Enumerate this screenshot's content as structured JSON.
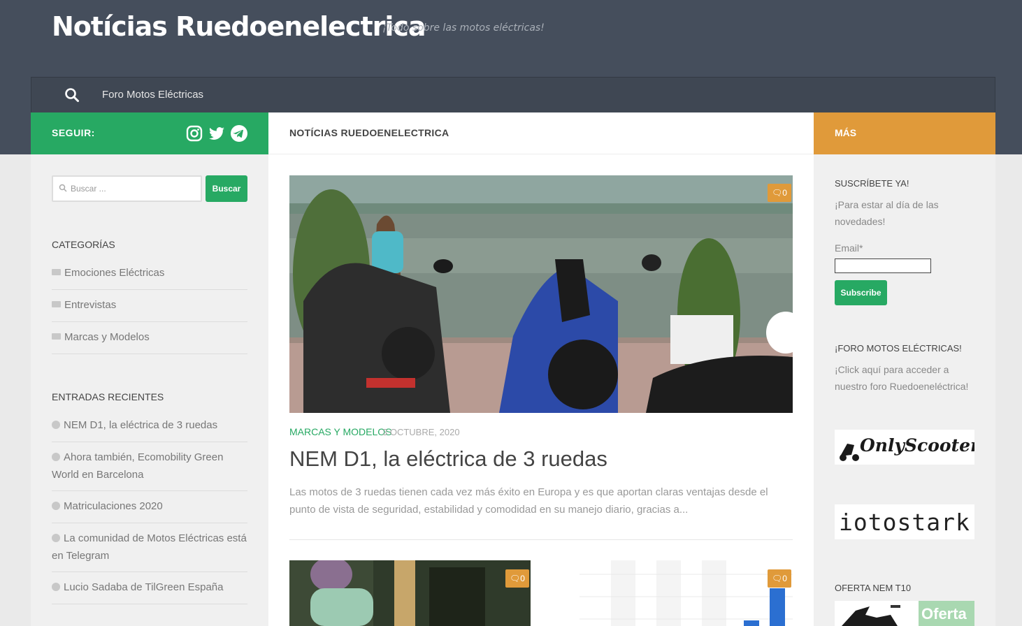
{
  "header": {
    "site_title": "Notícias Ruedoenelectrica",
    "site_description": "¡Todo sobre las motos eléctricas!",
    "bg_color": "#454e5c"
  },
  "nav": {
    "search_icon": "search-icon",
    "links": [
      {
        "label": "Foro Motos Eléctricas"
      }
    ]
  },
  "left_sidebar": {
    "follow_label": "SEGUIR:",
    "social_icons": [
      "instagram-icon",
      "twitter-icon",
      "telegram-icon"
    ],
    "search": {
      "placeholder": "Buscar ...",
      "button_label": "Buscar"
    },
    "categories_title": "CATEGORÍAS",
    "categories": [
      {
        "label": "Emociones Eléctricas"
      },
      {
        "label": "Entrevistas"
      },
      {
        "label": "Marcas y Modelos"
      }
    ],
    "recent_title": "ENTRADAS RECIENTES",
    "recent_posts": [
      {
        "label": "NEM D1, la eléctrica de 3 ruedas"
      },
      {
        "label": "Ahora también, Ecomobility Green World en Barcelona"
      },
      {
        "label": "Matriculaciones 2020"
      },
      {
        "label": "La comunidad de Motos Eléctricas está en Telegram"
      },
      {
        "label": "Lucio Sadaba de TilGreen España"
      }
    ],
    "accent_color": "#27a963"
  },
  "main": {
    "heading": "NOTÍCIAS RUEDOENELECTRICA",
    "featured_post": {
      "comments": "0",
      "category": "MARCAS Y MODELOS",
      "date": "3 OCTUBRE, 2020",
      "title": "NEM D1, la eléctrica de 3 ruedas",
      "excerpt": "Las motos de 3 ruedas tienen cada vez más éxito en Europa y es que aportan claras ventajas desde el punto de vista de seguridad, estabilidad y comodidad en su manejo diario, gracias a..."
    },
    "thumb_posts": [
      {
        "comments": "0"
      },
      {
        "comments": "0"
      }
    ]
  },
  "right_sidebar": {
    "more_label": "MÁS",
    "subscribe_title": "SUSCRÍBETE YA!",
    "subscribe_text": "¡Para estar al día de las novedades!",
    "email_label": "Email*",
    "email_value": "",
    "subscribe_button": "Subscribe",
    "forum_title": "¡FORO MOTOS ELÉCTRICAS!",
    "forum_text": "¡Click aquí para acceder a nuestro foro Ruedoeneléctrica!",
    "banner1": "OnlyScooter",
    "banner2": "iotostark",
    "offer_title": "OFERTA NEM T10",
    "offer_badge": "Oferta",
    "accent_color": "#e09a3a"
  }
}
